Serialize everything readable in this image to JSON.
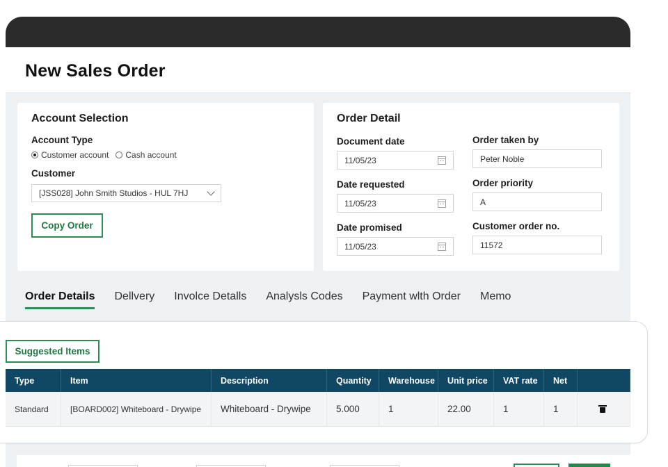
{
  "page": {
    "title": "New Sales Order"
  },
  "account_selection": {
    "title": "Account Selection",
    "account_type_label": "Account Type",
    "options": [
      "Customer account",
      "Cash account"
    ],
    "selected": "Customer account",
    "customer_label": "Customer",
    "customer_value": "[JSS028] John Smith Studios - HUL 7HJ",
    "copy_order_label": "Copy Order"
  },
  "order_detail": {
    "title": "Order Detail",
    "document_date": {
      "label": "Document date",
      "value": "11/05/23"
    },
    "date_requested": {
      "label": "Date requested",
      "value": "11/05/23"
    },
    "date_promised": {
      "label": "Date promised",
      "value": "11/05/23"
    },
    "order_taken_by": {
      "label": "Order taken by",
      "value": "Peter Noble"
    },
    "order_priority": {
      "label": "Order priority",
      "value": "A"
    },
    "customer_order_no": {
      "label": "Customer order no.",
      "value": "11572"
    }
  },
  "tabs": [
    "Order Details",
    "Dellvery",
    "Involce Detalls",
    "Analysls Codes",
    "Payment wlth Order",
    "Memo"
  ],
  "active_tab": "Order Details",
  "suggested_items_label": "Suggested Items",
  "table": {
    "columns": [
      "Type",
      "Item",
      "Description",
      "Quantity",
      "Warehouse",
      "Unit price",
      "VAT rate",
      "Net"
    ],
    "rows": [
      {
        "type": "Standard",
        "item": "[BOARD002] Whiteboard - Drywipe",
        "description": "Whiteboard - Drywipe",
        "quantity": "5.000",
        "warehouse": "1",
        "unit_price": "22.00",
        "vat_rate": "1",
        "net": "1"
      }
    ]
  },
  "icons": {
    "calendar": "calendar-icon",
    "dropdown": "chevron-down-icon",
    "delete": "trash-icon"
  },
  "colors": {
    "accent_green": "#2e8b57",
    "table_header": "#0f4764",
    "titlebar": "#2b2b2b",
    "background": "#edf1f3"
  }
}
